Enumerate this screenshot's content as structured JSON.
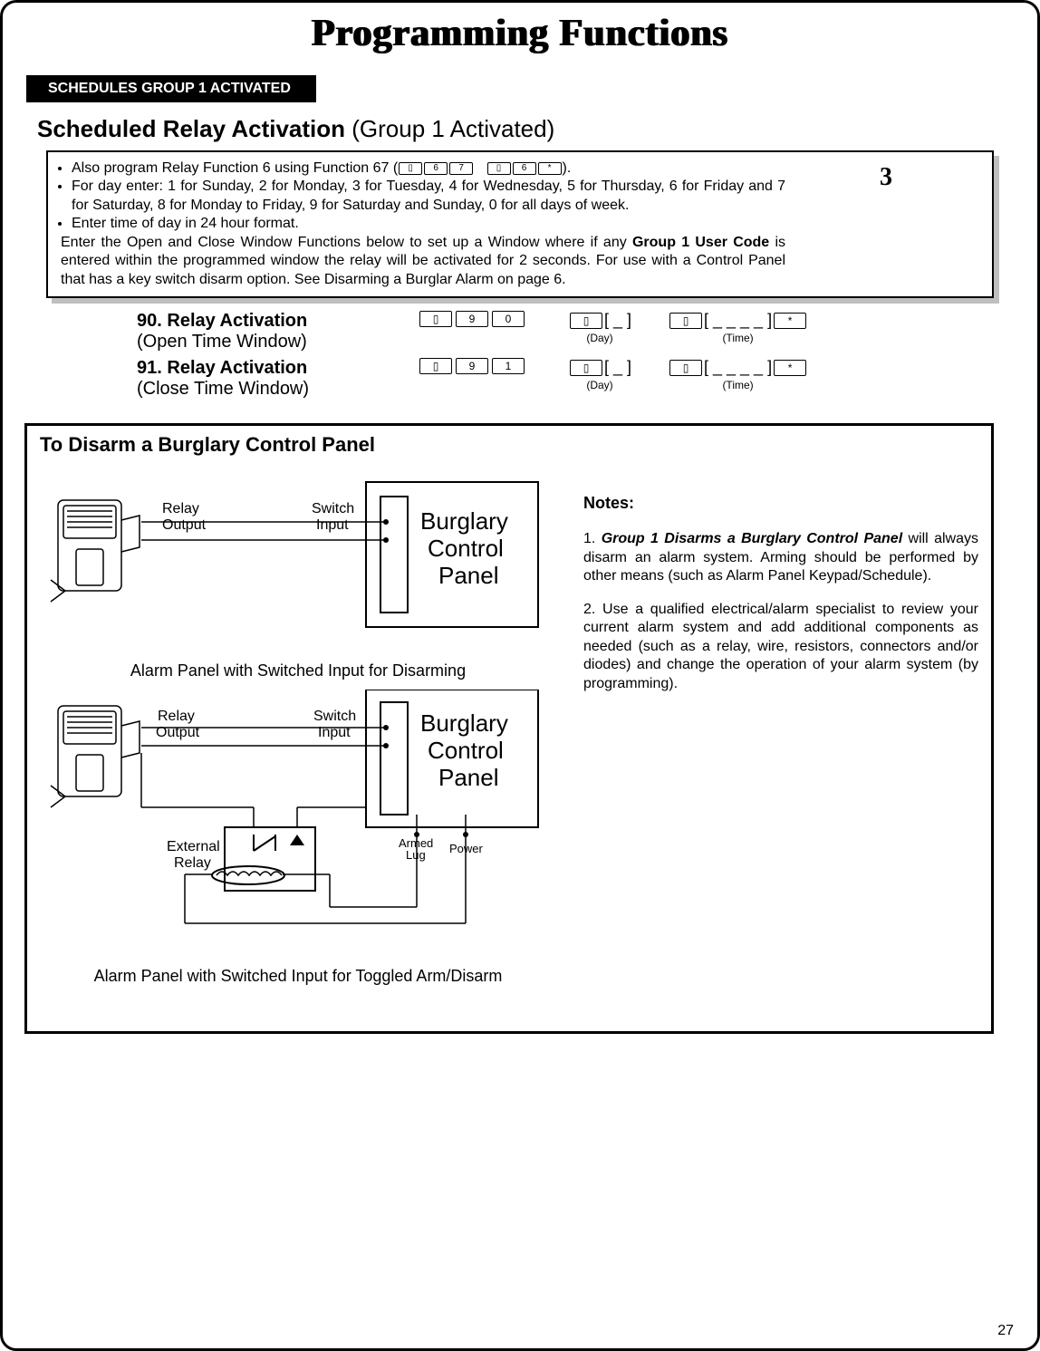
{
  "title": "Programming Functions",
  "tab": "SCHEDULES GROUP 1 ACTIVATED",
  "section_heading": {
    "bold": "Scheduled Relay Activation",
    "rest": " (Group 1 Activated)"
  },
  "info": {
    "b1_pre": "Also program Relay Function 6 using Function 67 (",
    "b1_keys_a": [
      "▯",
      "6",
      "7"
    ],
    "b1_keys_b": [
      "▯",
      "6",
      "*"
    ],
    "b1_post": ").",
    "b2": "For day enter: 1 for Sunday, 2 for Monday, 3 for Tuesday, 4 for Wednesday, 5 for Thursday, 6 for Friday and  7 for Saturday, 8 for Monday to Friday, 9 for Saturday and Sunday, 0 for all days of week.",
    "b3": "Enter time of day in 24 hour format.",
    "tail": "Enter the Open and Close Window Functions below to set up a Window where if any ",
    "tail_bold": "Group 1 User Code",
    "tail2": " is entered within the programmed window the relay will be activated for 2 seconds.  For use with a Control Panel that has a key switch disarm option. See Disarming a Burglar Alarm on page 6.",
    "level": "3"
  },
  "functions": [
    {
      "num": "90.",
      "name": "Relay Activation",
      "sub": "(Open Time Window)",
      "code_keys": [
        "▯",
        "9",
        "0"
      ]
    },
    {
      "num": "91.",
      "name": "Relay Activation",
      "sub": "(Close Time Window)",
      "code_keys": [
        "▯",
        "9",
        "1"
      ]
    }
  ],
  "field_labels": {
    "day_slot": "[ _ ]",
    "day_caption": "(Day)",
    "time_slot": "[ _ _ _ _ ]",
    "time_caption": "(Time)"
  },
  "disarm": {
    "title": "To Disarm a Burglary Control Panel",
    "d1": {
      "relay_output": "Relay\nOutput",
      "switch_input": "Switch\nInput",
      "panel": "Burglary\nControl\nPanel",
      "caption": "Alarm Panel with Switched Input for Disarming"
    },
    "d2": {
      "relay_output": "Relay\nOutput",
      "switch_input": "Switch\nInput",
      "panel": "Burglary\nControl\nPanel",
      "external_relay": "External\nRelay",
      "armed_lug": "Armed\nLug",
      "power": "Power",
      "caption": "Alarm Panel with Switched Input for Toggled Arm/Disarm"
    },
    "notes": {
      "head": "Notes:",
      "n1_pre": "1. ",
      "n1_bold": "Group 1 Disarms a Burglary Control Panel",
      "n1_rest": " will always disarm an alarm system. Arming should be performed by other means (such as Alarm Panel Keypad/Schedule).",
      "n2": "2. Use a qualified electrical/alarm specialist to review your current alarm system and add additional components as needed (such as a relay, wire, resistors, connectors and/or diodes) and change the operation of your alarm system (by programming)."
    }
  },
  "pagenum": "27"
}
